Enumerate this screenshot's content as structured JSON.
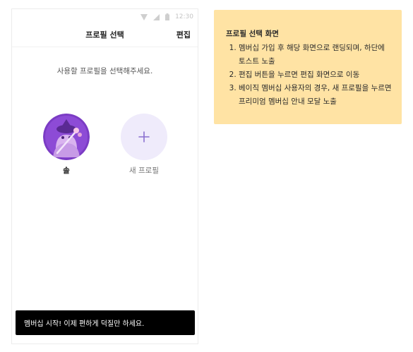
{
  "status_bar": {
    "time": "12:30"
  },
  "header": {
    "title": "프로필 선택",
    "edit_label": "편집"
  },
  "prompt": "사용할 프로필을 선택해주세요.",
  "profiles": [
    {
      "name": "솔"
    },
    {
      "name": "새 프로필",
      "icon": "plus-icon"
    }
  ],
  "toast": "멤버십 시작! 이제 편하게 덕질만 하세요.",
  "note": {
    "title": "프로필 선택 화면",
    "items": [
      "멤버십 가입 후 해당 화면으로 랜딩되며, 하단에 토스트 노출",
      "편집 버튼을 누르면 편집 화면으로 이동",
      "베이직 멤버십 사용자의 경우, 새 프로필을 누르면 프리미엄 멤버십 안내 모달 노출"
    ]
  },
  "colors": {
    "note_bg": "#ffe3a4",
    "add_circle_bg": "#efebfb",
    "accent_purple": "#8a6fd0",
    "toast_bg": "#000000"
  }
}
